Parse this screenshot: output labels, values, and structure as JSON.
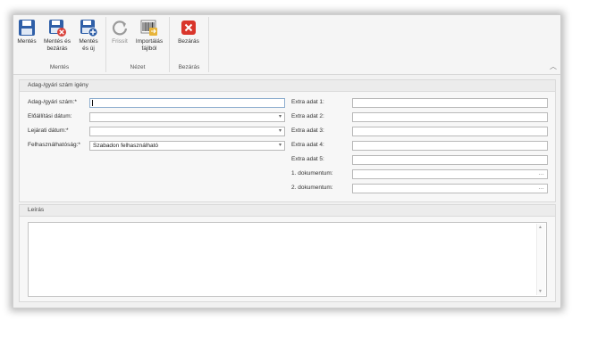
{
  "ribbon": {
    "buttons": {
      "save": "Mentés",
      "save_close_line1": "Mentés és",
      "save_close_line2": "bezárás",
      "save_new_line1": "Mentés",
      "save_new_line2": "és új",
      "refresh": "Frissít",
      "import_line1": "Importálás",
      "import_line2": "fájlból",
      "close": "Bezárás"
    },
    "groups": {
      "save": "Mentés",
      "view": "Nézet",
      "close": "Bezárás"
    },
    "collapse_icon": "chevron-up"
  },
  "form": {
    "title": "Adag-/gyári szám igény",
    "left_fields": {
      "batch_label": "Adag-/gyári szám:*",
      "batch_value": "",
      "production_date_label": "Előállítási dátum:",
      "production_date_value": "",
      "expiry_date_label": "Lejárati dátum:*",
      "expiry_date_value": "",
      "usability_label": "Felhasználhatóság:*",
      "usability_value": "Szabadon felhasználható"
    },
    "right_fields": {
      "extra1_label": "Extra adat 1:",
      "extra2_label": "Extra adat 2:",
      "extra3_label": "Extra adat 3:",
      "extra4_label": "Extra adat 4:",
      "extra5_label": "Extra adat 5:",
      "doc1_label": "1. dokumentum:",
      "doc2_label": "2. dokumentum:"
    },
    "dropdown_glyph": "▾",
    "ellipsis_glyph": "…"
  },
  "description": {
    "title": "Leírás",
    "value": ""
  },
  "colors": {
    "save_icon": "#2f5fa8",
    "delete_badge": "#d9413a",
    "add_badge": "#2f5fa8",
    "close_button": "#d9352b"
  }
}
